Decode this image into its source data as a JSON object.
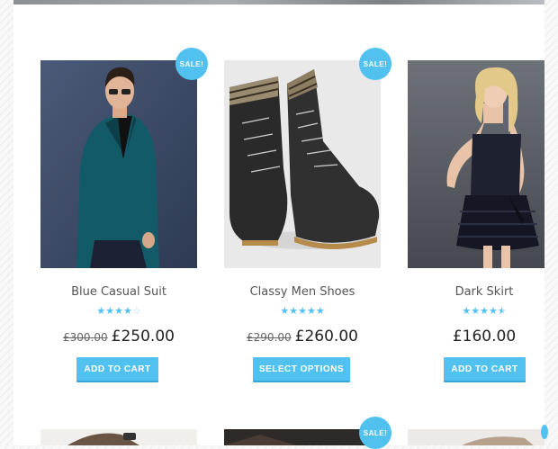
{
  "products": [
    {
      "name": "Blue Casual Suit",
      "sale_badge": "SALE!",
      "rating": 4,
      "rating_max": 5,
      "old_price": "£300.00",
      "price": "£250.00",
      "button_label": "ADD TO CART",
      "image": "man-in-teal-blazer-photo"
    },
    {
      "name": "Classy Men Shoes",
      "sale_badge": "SALE!",
      "rating": 5,
      "rating_max": 5,
      "old_price": "£290.00",
      "price": "£260.00",
      "button_label": "SELECT OPTIONS",
      "image": "black-leather-boots-photo"
    },
    {
      "name": "Dark Skirt",
      "rating": 4.5,
      "rating_max": 5,
      "price": "£160.00",
      "button_label": "ADD TO CART",
      "image": "woman-in-black-dress-photo"
    }
  ],
  "second_row": {
    "middle_sale_badge": "SALE!"
  },
  "colors": {
    "accent": "#51c1f0",
    "text": "#555555",
    "price": "#222222"
  }
}
